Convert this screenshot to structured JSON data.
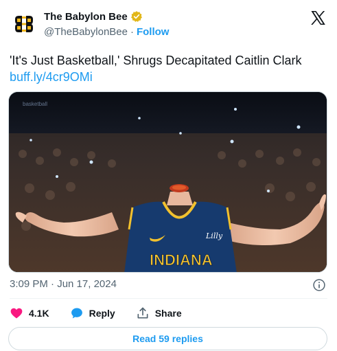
{
  "author": {
    "display_name": "The Babylon Bee",
    "handle": "@TheBabylonBee",
    "separator": "·",
    "follow_label": "Follow"
  },
  "tweet": {
    "text": "'It's Just Basketball,' Shrugs Decapitated Caitlin Clark",
    "link": "buff.ly/4cr9OMi"
  },
  "media": {
    "jersey_text": "INDIANA",
    "jersey_brand": "Lilly",
    "banner_text": "basketball"
  },
  "timestamp": "3:09 PM · Jun 17, 2024",
  "actions": {
    "likes_count": "4.1K",
    "reply_label": "Reply",
    "share_label": "Share"
  },
  "read_replies_label": "Read 59 replies",
  "colors": {
    "accent": "#1d9bf0",
    "like": "#f91880",
    "verified": "#e2b719",
    "text_secondary": "#536471"
  },
  "icons": {
    "logo": "babylon-bee-logo-icon",
    "verified": "verified-badge-icon",
    "platform": "x-logo-icon",
    "info": "info-icon",
    "like": "heart-icon",
    "reply": "speech-bubble-icon",
    "share": "share-upload-icon"
  }
}
